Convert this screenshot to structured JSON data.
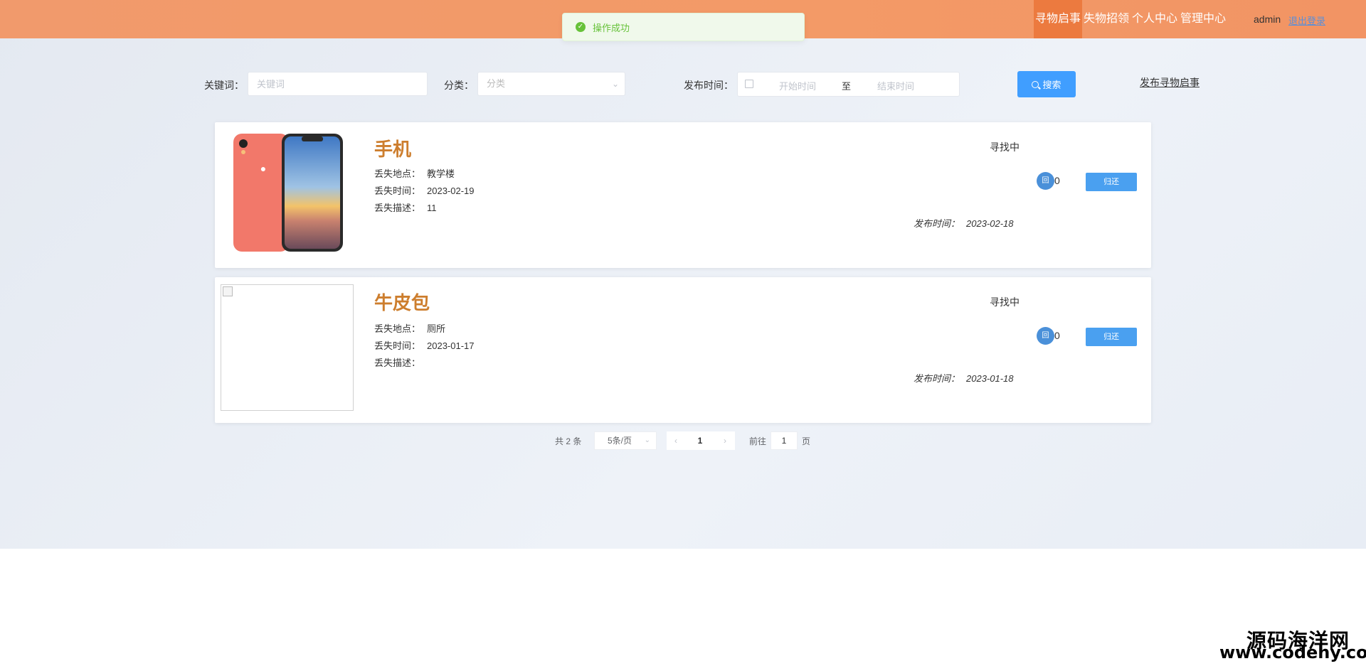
{
  "header": {
    "nav": [
      "寻物启事",
      "失物招领",
      "个人中心",
      "管理中心"
    ],
    "active_index": 0,
    "username": "admin",
    "logout": "退出登录",
    "colors": {
      "bar": "#f39a67",
      "active": "#ec7a3f"
    }
  },
  "toast": {
    "icon": "check-circle-icon",
    "message": "操作成功"
  },
  "search": {
    "keyword_label": "关键词：",
    "keyword_placeholder": "关键词",
    "category_label": "分类：",
    "category_placeholder": "分类",
    "time_label": "发布时间：",
    "start_placeholder": "开始时间",
    "range_sep": "至",
    "end_placeholder": "结束时间",
    "search_button": "搜索",
    "publish_link": "发布寻物启事"
  },
  "items": [
    {
      "title": "手机",
      "location_label": "丢失地点：",
      "location": "教学楼",
      "time_label": "丢失时间：",
      "time": "2023-02-19",
      "desc_label": "丢失描述：",
      "desc": "11",
      "status": "寻找中",
      "pub_label": "发布时间：",
      "pub_time": "2023-02-18",
      "like_icon": "回",
      "likes": "0",
      "action": "归还"
    },
    {
      "title": "牛皮包",
      "location_label": "丢失地点：",
      "location": "厕所",
      "time_label": "丢失时间：",
      "time": "2023-01-17",
      "desc_label": "丢失描述：",
      "desc": "",
      "status": "寻找中",
      "pub_label": "发布时间：",
      "pub_time": "2023-01-18",
      "like_icon": "回",
      "likes": "0",
      "action": "归还"
    }
  ],
  "pagination": {
    "total": "共 2 条",
    "page_size": "5条/页",
    "prev": "‹",
    "current": "1",
    "next": "›",
    "goto": "前往",
    "goto_value": "1",
    "unit": "页"
  },
  "watermark": {
    "cn": "源码海洋网",
    "url": "www.codehy.com"
  }
}
